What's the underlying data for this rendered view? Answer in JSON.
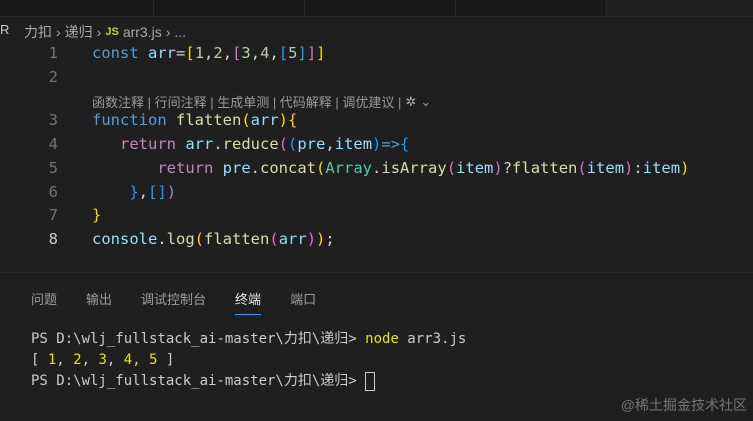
{
  "breadcrumb": {
    "items": [
      "力扣",
      "递归"
    ],
    "file": "arr3.js",
    "file_icon": "JS",
    "more": "..."
  },
  "editor": {
    "lines": [
      {
        "n": "1",
        "tokens": [
          [
            "const ",
            "kw"
          ],
          [
            "arr",
            "var"
          ],
          [
            "=",
            "pl"
          ],
          [
            "[",
            "b1"
          ],
          [
            "1",
            "num"
          ],
          [
            ",",
            "pl"
          ],
          [
            "2",
            "num"
          ],
          [
            ",",
            "pl"
          ],
          [
            "[",
            "b2"
          ],
          [
            "3",
            "num"
          ],
          [
            ",",
            "pl"
          ],
          [
            "4",
            "num"
          ],
          [
            ",",
            "pl"
          ],
          [
            "[",
            "b3"
          ],
          [
            "5",
            "num"
          ],
          [
            "]",
            "b3"
          ],
          [
            "]",
            "b2"
          ],
          [
            "]",
            "b1"
          ]
        ]
      },
      {
        "n": "2",
        "tokens": []
      },
      {
        "n": "3",
        "tokens": [
          [
            "function ",
            "kw"
          ],
          [
            "flatten",
            "fn"
          ],
          [
            "(",
            "b1"
          ],
          [
            "arr",
            "var"
          ],
          [
            ")",
            "b1"
          ],
          [
            "{",
            "b1"
          ]
        ]
      },
      {
        "n": "4",
        "tokens": [
          [
            "   ",
            "pl"
          ],
          [
            "return ",
            "ctl"
          ],
          [
            "arr",
            "var"
          ],
          [
            ".",
            "pl"
          ],
          [
            "reduce",
            "fn"
          ],
          [
            "(",
            "b2"
          ],
          [
            "(",
            "b3"
          ],
          [
            "pre",
            "var"
          ],
          [
            ",",
            "pl"
          ],
          [
            "item",
            "var"
          ],
          [
            ")",
            "b3"
          ],
          [
            "=>",
            "kw"
          ],
          [
            "{",
            "b3"
          ]
        ]
      },
      {
        "n": "5",
        "tokens": [
          [
            "       ",
            "pl"
          ],
          [
            "return ",
            "ctl"
          ],
          [
            "pre",
            "var"
          ],
          [
            ".",
            "pl"
          ],
          [
            "concat",
            "fn"
          ],
          [
            "(",
            "b1"
          ],
          [
            "Array",
            "cls"
          ],
          [
            ".",
            "pl"
          ],
          [
            "isArray",
            "fn"
          ],
          [
            "(",
            "b2"
          ],
          [
            "item",
            "var"
          ],
          [
            ")",
            "b2"
          ],
          [
            "?",
            "pl"
          ],
          [
            "flatten",
            "fn"
          ],
          [
            "(",
            "b2"
          ],
          [
            "item",
            "var"
          ],
          [
            ")",
            "b2"
          ],
          [
            ":",
            "pl"
          ],
          [
            "item",
            "var"
          ],
          [
            ")",
            "b1"
          ]
        ]
      },
      {
        "n": "6",
        "tokens": [
          [
            "    ",
            "pl"
          ],
          [
            "}",
            "b3"
          ],
          [
            ",",
            "pl"
          ],
          [
            "[",
            "b3"
          ],
          [
            "]",
            "b3"
          ],
          [
            ")",
            "b2"
          ]
        ]
      },
      {
        "n": "7",
        "tokens": [
          [
            "}",
            "b1"
          ]
        ]
      },
      {
        "n": "8",
        "tokens": [
          [
            "console",
            "var"
          ],
          [
            ".",
            "pl"
          ],
          [
            "log",
            "fn"
          ],
          [
            "(",
            "b1"
          ],
          [
            "flatten",
            "fn"
          ],
          [
            "(",
            "b2"
          ],
          [
            "arr",
            "var"
          ],
          [
            ")",
            "b2"
          ],
          [
            ")",
            "b1"
          ],
          [
            ";",
            "pl"
          ]
        ]
      }
    ],
    "codelens": "函数注释 | 行间注释 | 生成单测 | 代码解释 | 调优建议 |"
  },
  "panel": {
    "tabs": [
      "问题",
      "输出",
      "调试控制台",
      "终端",
      "端口"
    ],
    "active_tab": "终端"
  },
  "terminal": {
    "prompt": "PS D:\\wlj_fullstack_ai-master\\力扣\\递归> ",
    "command": "node arr3.js",
    "output_open": "[ ",
    "output_values": [
      "1",
      "2",
      "3",
      "4",
      "5"
    ],
    "output_close": " ]"
  },
  "watermark": "@稀土掘金技术社区"
}
